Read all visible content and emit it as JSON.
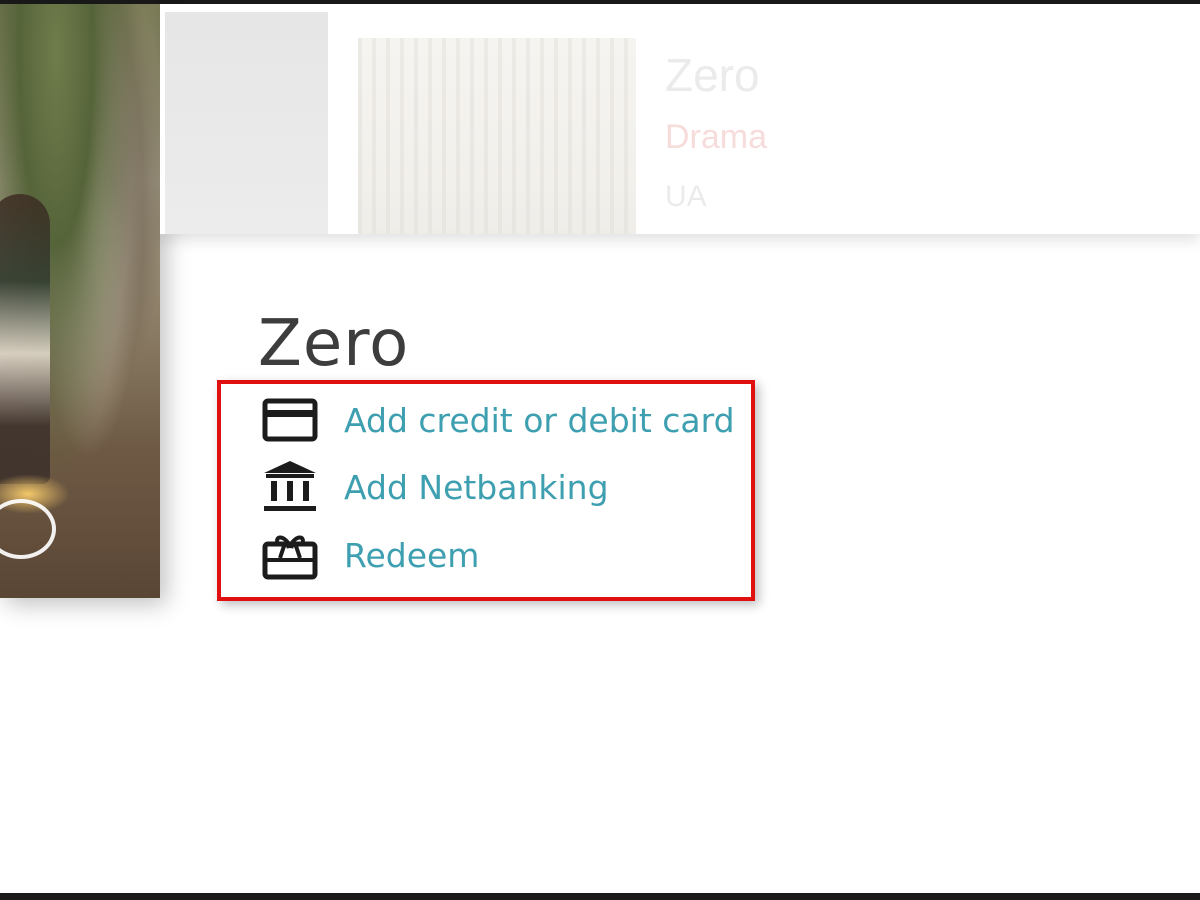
{
  "header": {
    "title": "Zero",
    "genre": "Drama",
    "rating": "UA"
  },
  "main": {
    "title": "Zero",
    "payment_options": [
      {
        "label": "Add credit or debit card",
        "icon": "credit-card-icon"
      },
      {
        "label": "Add Netbanking",
        "icon": "bank-icon"
      },
      {
        "label": "Redeem",
        "icon": "gift-card-icon"
      }
    ]
  },
  "colors": {
    "link": "#3d9fb0",
    "highlight": "#e01010",
    "title": "#3d3d3d"
  }
}
